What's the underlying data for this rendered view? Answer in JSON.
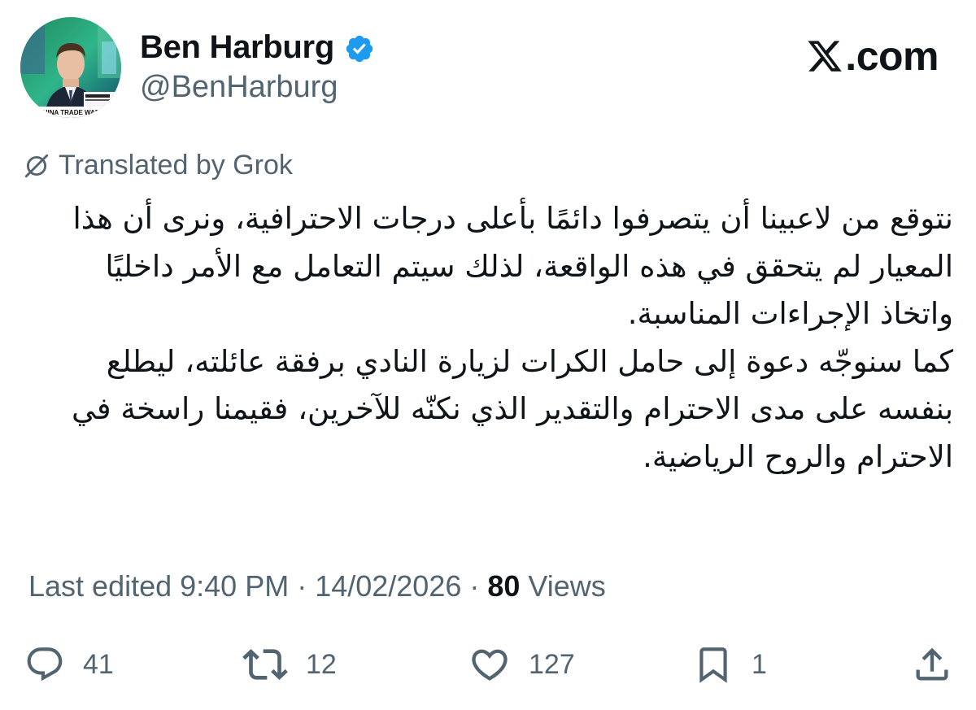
{
  "author": {
    "display_name": "Ben Harburg",
    "handle": "@BenHarburg",
    "avatar_caption": "CHINA TRADE WAR"
  },
  "brand": {
    "site": ".com",
    "icon": "x-logo-icon"
  },
  "translation": {
    "label": "Translated by Grok",
    "icon": "translate-off-icon"
  },
  "tweet": {
    "paragraphs": [
      "نتوقع من لاعبينا أن يتصرفوا دائمًا بأعلى درجات الاحترافية، ونرى أن هذا المعيار لم يتحقق في هذه الواقعة، لذلك سيتم التعامل مع الأمر داخليًا واتخاذ الإجراءات المناسبة.",
      "كما سنوجّه دعوة إلى حامل الكرات لزيارة النادي برفقة عائلته، ليطلع بنفسه على مدى الاحترام والتقدير الذي نكنّه للآخرين، فقيمنا راسخة في الاحترام والروح الرياضية."
    ]
  },
  "meta": {
    "prefix": "Last edited 9:40 PM · 14/02/2026 · ",
    "views_count": "80",
    "views_suffix": " Views"
  },
  "actions": {
    "replies": "41",
    "reposts": "12",
    "likes": "127",
    "bookmarks": "1"
  },
  "colors": {
    "text": "#0f1419",
    "secondary": "#536471",
    "verified": "#1d9bf0"
  }
}
